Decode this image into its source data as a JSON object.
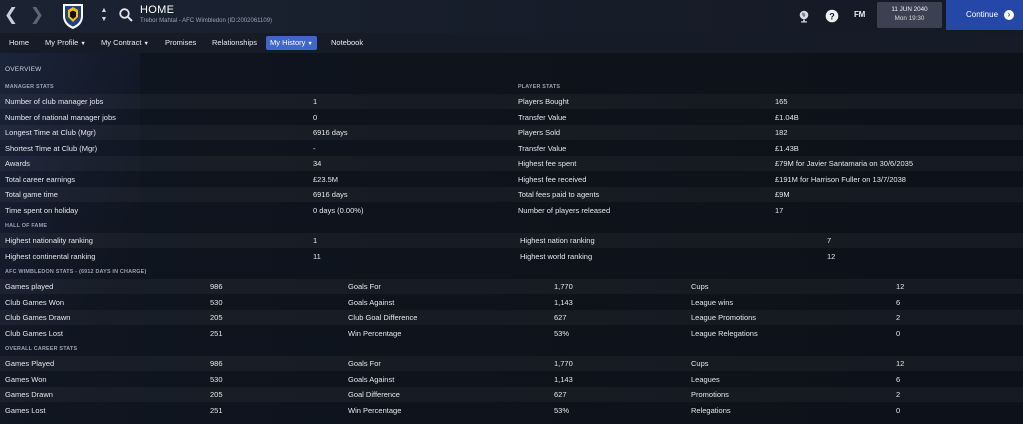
{
  "header": {
    "title": "HOME",
    "subtitle": "Trebor Mahtal - AFC Wimbledon (ID:2002061109)",
    "date": "11 JUN 2040",
    "time": "Mon 19:30",
    "continue_label": "Continue",
    "fm_logo": "FM"
  },
  "menu": {
    "items": [
      {
        "label": "Home",
        "dropdown": false
      },
      {
        "label": "My Profile",
        "dropdown": true
      },
      {
        "label": "My Contract",
        "dropdown": true
      },
      {
        "label": "Promises",
        "dropdown": false
      },
      {
        "label": "Relationships",
        "dropdown": false
      },
      {
        "label": "My History",
        "dropdown": true,
        "active": true
      },
      {
        "label": "Notebook",
        "dropdown": false
      }
    ]
  },
  "overview_label": "OVERVIEW",
  "manager_stats": {
    "heading": "MANAGER STATS",
    "rows": [
      {
        "label": "Number of club manager jobs",
        "value": "1"
      },
      {
        "label": "Number of national manager jobs",
        "value": "0"
      },
      {
        "label": "Longest Time at Club (Mgr)",
        "value": "6916 days"
      },
      {
        "label": "Shortest Time at Club (Mgr)",
        "value": "-"
      },
      {
        "label": "Awards",
        "value": "34"
      },
      {
        "label": "Total career earnings",
        "value": "£23.5M"
      },
      {
        "label": "Total game time",
        "value": "6916 days"
      },
      {
        "label": "Time spent on holiday",
        "value": "0 days (0.00%)"
      }
    ]
  },
  "player_stats": {
    "heading": "PLAYER STATS",
    "rows": [
      {
        "label": "Players Bought",
        "value": "165"
      },
      {
        "label": "Transfer Value",
        "value": "£1.04B"
      },
      {
        "label": "Players Sold",
        "value": "182"
      },
      {
        "label": "Transfer Value",
        "value": "£1.43B"
      },
      {
        "label": "Highest fee spent",
        "value": "£79M for Javier Santamaria on 30/6/2035"
      },
      {
        "label": "Highest fee received",
        "value": "£191M for Harrison Fuller on 13/7/2038"
      },
      {
        "label": "Total fees paid to agents",
        "value": "£9M"
      },
      {
        "label": "Number of players released",
        "value": "17"
      }
    ]
  },
  "hall_of_fame": {
    "heading": "HALL OF FAME",
    "rows": [
      {
        "label": "Highest nationality ranking",
        "value": "1",
        "label2": "Highest nation ranking",
        "value2": "7"
      },
      {
        "label": "Highest continental ranking",
        "value": "11",
        "label2": "Highest world ranking",
        "value2": "12"
      }
    ]
  },
  "club_stats": {
    "heading": "AFC WIMBLEDON STATS - (6912 DAYS IN CHARGE)",
    "rows": [
      [
        "Games played",
        "986",
        "Goals For",
        "1,770",
        "Cups",
        "12"
      ],
      [
        "Club Games Won",
        "530",
        "Goals Against",
        "1,143",
        "League wins",
        "6"
      ],
      [
        "Club Games Drawn",
        "205",
        "Club Goal Difference",
        "627",
        "League Promotions",
        "2"
      ],
      [
        "Club Games Lost",
        "251",
        "Win Percentage",
        "53%",
        "League Relegations",
        "0"
      ]
    ]
  },
  "career_stats": {
    "heading": "OVERALL CAREER STATS",
    "rows": [
      [
        "Games Played",
        "986",
        "Goals For",
        "1,770",
        "Cups",
        "12"
      ],
      [
        "Games Won",
        "530",
        "Goals Against",
        "1,143",
        "Leagues",
        "6"
      ],
      [
        "Games Drawn",
        "205",
        "Goal Difference",
        "627",
        "Promotions",
        "2"
      ],
      [
        "Games Lost",
        "251",
        "Win Percentage",
        "53%",
        "Relegations",
        "0"
      ]
    ]
  },
  "colors": {
    "accent": "#3f66c8",
    "continue_button": "#2447a8",
    "background": "#0e1219"
  }
}
